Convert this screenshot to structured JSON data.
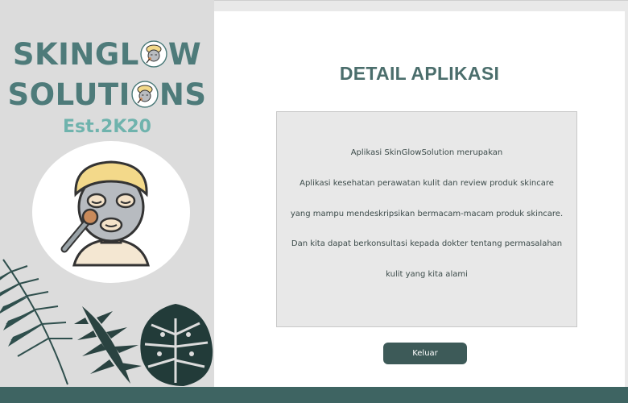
{
  "brand": {
    "line1": "SKINGL",
    "line1_tail": "W",
    "line2": "SOLUTI",
    "line2_tail": "NS",
    "established": "Est.2K20"
  },
  "page": {
    "title": "DETAIL APLIKASI"
  },
  "description": {
    "lines": [
      "Aplikasi SkinGlowSolution merupakan",
      "Aplikasi kesehatan perawatan kulit dan review produk skincare",
      "yang mampu mendeskripsikan bermacam-macam produk skincare.",
      "Dan kita dapat berkonsultasi kepada dokter tentang permasalahan",
      "kulit yang kita alami"
    ]
  },
  "actions": {
    "exit_label": "Keluar"
  },
  "colors": {
    "brand_teal": "#4e7b7a",
    "est_teal": "#6fb3ad",
    "button_bg": "#3d5a58",
    "bottom_bar": "#3e6462"
  },
  "icons": {
    "logo_o": "face-mask-icon",
    "avatar": "face-mask-avatar-icon",
    "decor": "monstera-leaf-icon"
  }
}
